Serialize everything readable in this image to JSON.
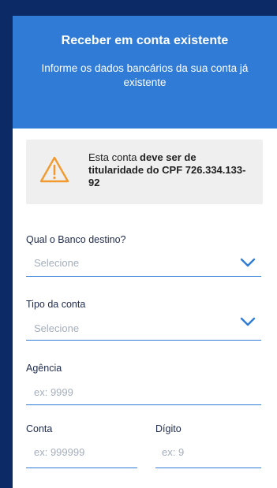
{
  "header": {
    "title": "Receber em conta existente",
    "subtitle": "Informe os dados bancários da sua conta já existente"
  },
  "notice": {
    "text_prefix": "Esta conta ",
    "text_bold": "deve ser de titularidade do CPF 726.334.133-92",
    "icon": "warning-triangle-icon"
  },
  "form": {
    "bank": {
      "label": "Qual o Banco destino?",
      "placeholder": "Selecione",
      "icon": "chevron-down-icon"
    },
    "account_type": {
      "label": "Tipo da conta",
      "placeholder": "Selecione",
      "icon": "chevron-down-icon"
    },
    "agency": {
      "label": "Agência",
      "placeholder": "ex: 9999"
    },
    "account": {
      "label": "Conta",
      "placeholder": "ex: 999999"
    },
    "digit": {
      "label": "Dígito",
      "placeholder": "ex: 9"
    }
  },
  "colors": {
    "background": "#0b2a66",
    "header": "#2f7bd6",
    "accent": "#2f7bd6",
    "warning": "#f29a2e"
  }
}
